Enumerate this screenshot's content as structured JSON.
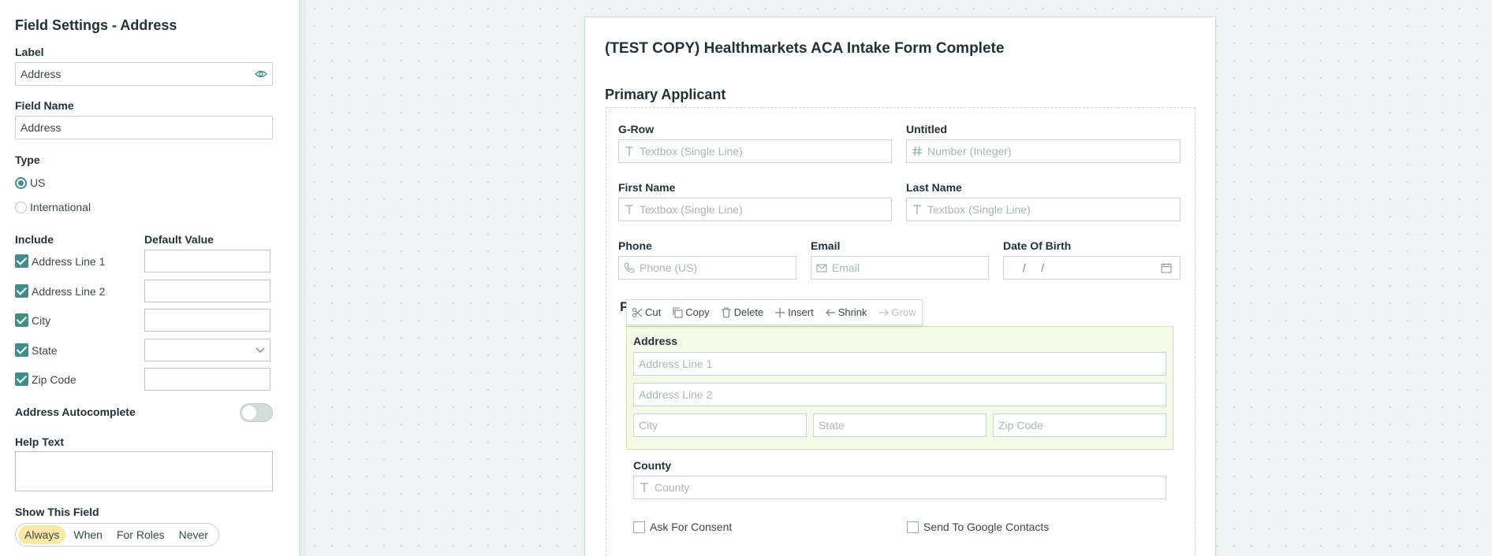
{
  "sidebar": {
    "title": "Field Settings - Address",
    "label_heading": "Label",
    "label_value": "Address",
    "fieldname_heading": "Field Name",
    "fieldname_value": "Address",
    "type_heading": "Type",
    "type_options": [
      "US",
      "International"
    ],
    "type_selected": "US",
    "include_heading": "Include",
    "default_heading": "Default Value",
    "include_items": [
      "Address Line 1",
      "Address Line 2",
      "City",
      "State",
      "Zip Code"
    ],
    "autocomplete_label": "Address Autocomplete",
    "help_heading": "Help Text",
    "show_heading": "Show This Field",
    "show_options": [
      "Always",
      "When",
      "For Roles",
      "Never"
    ],
    "show_selected": "Always"
  },
  "form": {
    "title": "(TEST COPY) Healthmarkets ACA Intake Form Complete",
    "section_title": "Primary Applicant",
    "fields": {
      "grow_label": "G-Row",
      "grow_placeholder": "Textbox (Single Line)",
      "untitled_label": "Untitled",
      "untitled_placeholder": "Number (Integer)",
      "first_label": "First Name",
      "first_placeholder": "Textbox (Single Line)",
      "last_label": "Last Name",
      "last_placeholder": "Textbox (Single Line)",
      "phone_label": "Phone",
      "phone_placeholder": "Phone (US)",
      "email_label": "Email",
      "email_placeholder": "Email",
      "dob_label": "Date Of Birth",
      "dob_placeholder": " /     /",
      "p_fragment": "P",
      "address_label": "Address",
      "addr1_placeholder": "Address Line 1",
      "addr2_placeholder": "Address Line 2",
      "city_placeholder": "City",
      "state_placeholder": "State",
      "zip_placeholder": "Zip Code",
      "county_label": "County",
      "county_placeholder": "County",
      "consent_label": "Ask For Consent",
      "google_label": "Send To Google Contacts"
    }
  },
  "toolbar": {
    "cut": "Cut",
    "copy": "Copy",
    "delete": "Delete",
    "insert": "Insert",
    "shrink": "Shrink",
    "grow": "Grow"
  },
  "colors": {
    "accent": "#3c8f8a",
    "selected_field_bg": "#f6fbe9",
    "segment_active": "#fde7a5"
  }
}
